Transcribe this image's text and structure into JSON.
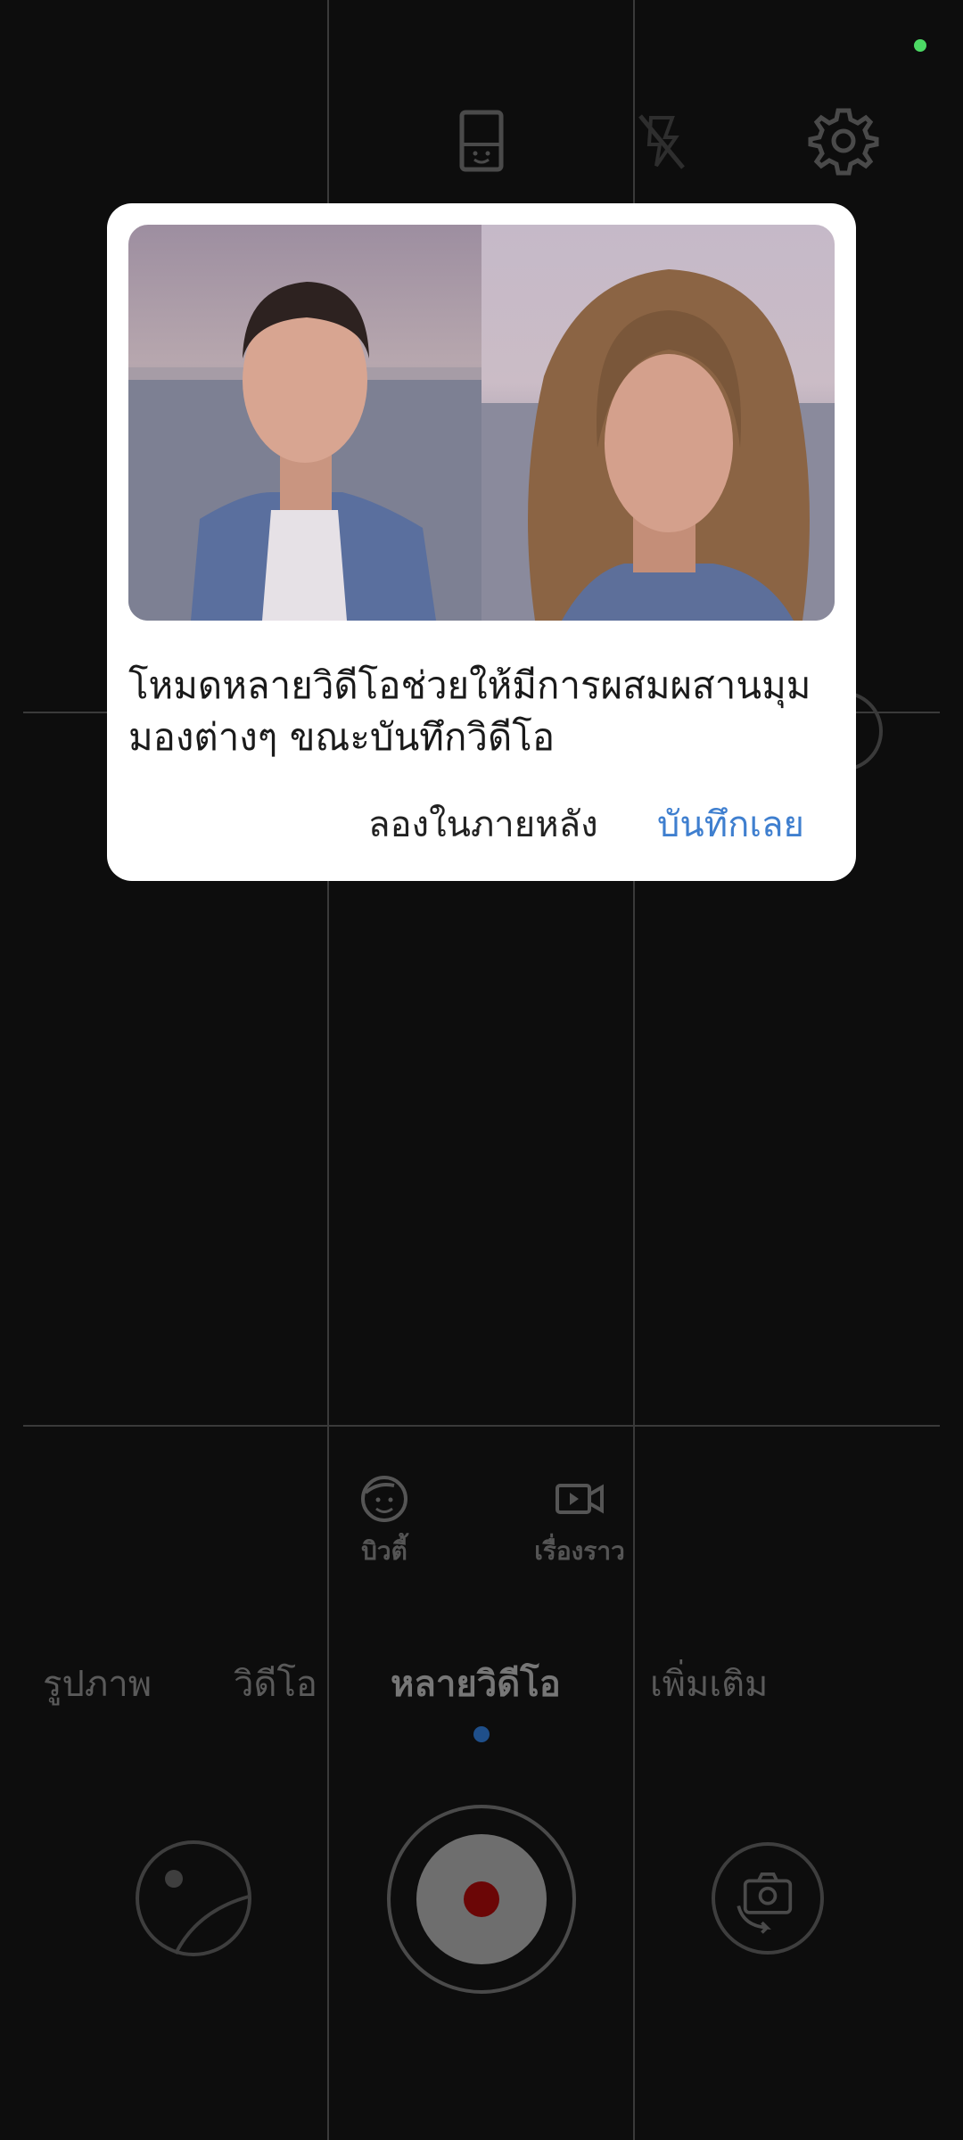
{
  "dialog": {
    "message": "โหมดหลายวิดีโอช่วยให้มีการผสมผสานมุมมองต่างๆ ขณะบันทึกวิดีโอ",
    "later_label": "ลองในภายหลัง",
    "record_label": "บันทึกเลย"
  },
  "top_icons": [
    "portrait-frame-icon",
    "flash-off-icon",
    "settings-gear-icon"
  ],
  "sub_modes": [
    {
      "label": "บิวตี้",
      "icon": "beauty-face-icon"
    },
    {
      "label": "เรื่องราว",
      "icon": "video-story-icon"
    }
  ],
  "modes": [
    {
      "label": "รูปภาพ"
    },
    {
      "label": "วิดีโอ"
    },
    {
      "label": "หลายวิดีโอ",
      "active": true
    },
    {
      "label": "เพิ่มเติม"
    }
  ],
  "colors": {
    "accent": "#3f7fcf",
    "status_dot": "#4cd964",
    "shutter_red": "#6b0606"
  }
}
